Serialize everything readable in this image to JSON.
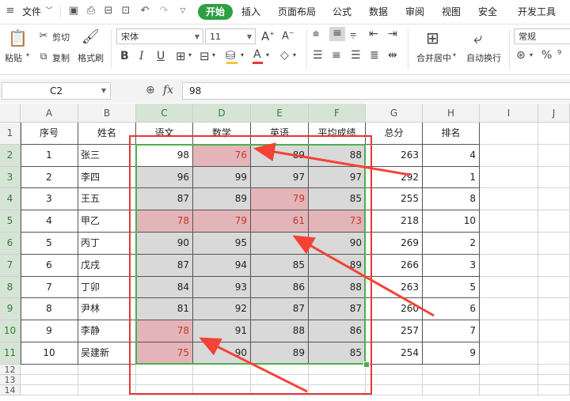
{
  "menu": {
    "file": "文件",
    "tabs": [
      "开始",
      "插入",
      "页面布局",
      "公式",
      "数据",
      "审阅",
      "视图",
      "安全",
      "开发工具"
    ]
  },
  "ribbon": {
    "paste": "粘贴",
    "cut": "剪切",
    "copy": "复制",
    "format_painter": "格式刷",
    "font_name": "宋体",
    "font_size": "11",
    "bold": "B",
    "italic": "I",
    "underline": "U",
    "font_color_letter": "A",
    "merge_center": "合并居中",
    "wrap_text": "自动换行",
    "number_format": "常规",
    "percent": "%"
  },
  "formula_bar": {
    "name_box": "C2",
    "fx": "fx",
    "value": "98"
  },
  "sheet": {
    "columns": [
      "A",
      "B",
      "C",
      "D",
      "E",
      "F",
      "G",
      "H",
      "I",
      "J"
    ],
    "rows": [
      "1",
      "2",
      "3",
      "4",
      "5",
      "6",
      "7",
      "8",
      "9",
      "10",
      "11",
      "12",
      "13",
      "14"
    ],
    "header": [
      "序号",
      "姓名",
      "语文",
      "数学",
      "英语",
      "平均成绩",
      "总分",
      "排名"
    ],
    "data": [
      [
        "1",
        "张三",
        "98",
        "76",
        "89",
        "88",
        "263",
        "4"
      ],
      [
        "2",
        "李四",
        "96",
        "99",
        "97",
        "97",
        "292",
        "1"
      ],
      [
        "3",
        "王五",
        "87",
        "89",
        "79",
        "85",
        "255",
        "8"
      ],
      [
        "4",
        "甲乙",
        "78",
        "79",
        "61",
        "73",
        "218",
        "10"
      ],
      [
        "5",
        "丙丁",
        "90",
        "95",
        "",
        "90",
        "269",
        "2"
      ],
      [
        "6",
        "戊戌",
        "87",
        "94",
        "85",
        "89",
        "266",
        "3"
      ],
      [
        "7",
        "丁卯",
        "84",
        "93",
        "86",
        "88",
        "263",
        "5"
      ],
      [
        "8",
        "尹林",
        "81",
        "92",
        "87",
        "87",
        "260",
        "6"
      ],
      [
        "9",
        "李静",
        "78",
        "91",
        "88",
        "86",
        "257",
        "7"
      ],
      [
        "10",
        "吴建新",
        "75",
        "90",
        "89",
        "85",
        "254",
        "9"
      ]
    ],
    "highlighted_cells": [
      [
        0,
        1
      ],
      [
        2,
        2
      ],
      [
        3,
        0
      ],
      [
        3,
        1
      ],
      [
        3,
        2
      ],
      [
        3,
        3
      ],
      [
        8,
        0
      ],
      [
        9,
        0
      ]
    ]
  },
  "colors": {
    "accent_green": "#2ea043",
    "highlight_fill": "#e3b4b8",
    "highlight_text": "#c0392b",
    "selection_fill": "#d9d9d9",
    "red_border": "#e53935",
    "green_border": "#4caf50",
    "arrow": "#f44336"
  }
}
